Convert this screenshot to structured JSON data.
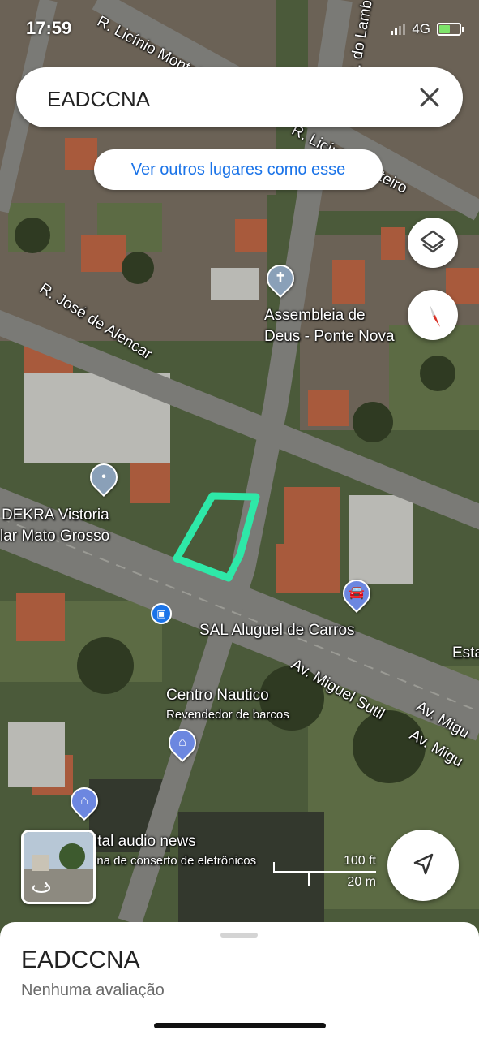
{
  "status_bar": {
    "time": "17:59",
    "network": "4G"
  },
  "search": {
    "query": "EADCCNA"
  },
  "suggestion_chip": {
    "label": "Ver outros lugares como esse"
  },
  "streets": {
    "licinio_top": "R. Licínio Monteiro",
    "licinio_right": "R. Licínio Monteiro",
    "do_lamb": "R. do Lamb",
    "jose_alencar": "R. José de Alencar",
    "miguel_sutil_1": "Av. Miguel Sutil",
    "miguel_sutil_2": "Av. Migu",
    "miguel_sutil_3": "Av. Migu"
  },
  "pois": {
    "assembleia_1": "Assembleia de",
    "assembleia_2": "Deus - Ponte Nova",
    "dekra_1": "DEKRA Vistoria",
    "dekra_2": "lar Mato Grosso",
    "sal": "SAL Aluguel de Carros",
    "nautico": "Centro Nautico",
    "nautico_sub": "Revendedor de barcos",
    "audio": "ital audio news",
    "audio_sub": "ina de conserto de eletrônicos",
    "esta": "Esta"
  },
  "scale": {
    "imperial": "100 ft",
    "metric": "20 m"
  },
  "place_sheet": {
    "title": "EADCCNA",
    "rating": "Nenhuma avaliação"
  },
  "colors": {
    "highlight": "#2ee8a8",
    "accent": "#1a73e8",
    "compass_red": "#d93025"
  },
  "icons": [
    "close-icon",
    "layers-icon",
    "compass-icon",
    "navigate-icon",
    "church-pin-icon",
    "shopping-pin-icon",
    "car-pin-icon",
    "bus-stop-icon",
    "place-pin-icon"
  ]
}
